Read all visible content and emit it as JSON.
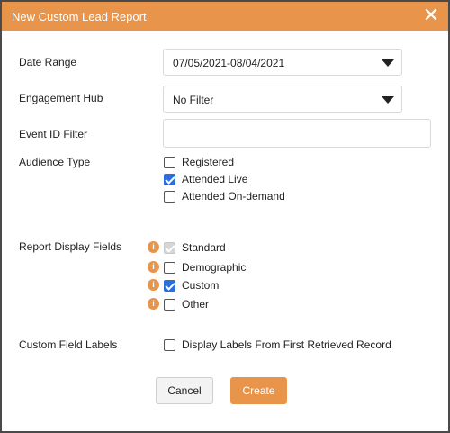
{
  "dialog": {
    "title": "New Custom Lead Report",
    "close_glyph": "✕"
  },
  "date_range": {
    "label": "Date Range",
    "value": "07/05/2021-08/04/2021"
  },
  "engagement_hub": {
    "label": "Engagement Hub",
    "value": "No Filter"
  },
  "event_id": {
    "label": "Event ID Filter",
    "value": "",
    "placeholder": ""
  },
  "audience_type": {
    "label": "Audience Type",
    "options": [
      {
        "label": "Registered",
        "checked": false
      },
      {
        "label": "Attended Live",
        "checked": true
      },
      {
        "label": "Attended On-demand",
        "checked": false
      }
    ]
  },
  "display_fields": {
    "label": "Report Display Fields",
    "info_glyph": "i",
    "options": [
      {
        "label": "Standard",
        "checked": true,
        "disabled": true
      },
      {
        "label": "Demographic",
        "checked": false,
        "disabled": false
      },
      {
        "label": "Custom",
        "checked": true,
        "disabled": false
      },
      {
        "label": "Other",
        "checked": false,
        "disabled": false
      }
    ]
  },
  "custom_labels": {
    "label": "Custom Field Labels",
    "option": {
      "label": "Display Labels From First Retrieved Record",
      "checked": false
    }
  },
  "buttons": {
    "cancel": "Cancel",
    "create": "Create"
  },
  "colors": {
    "accent": "#e8944a",
    "checkbox_checked": "#2a6fdb"
  },
  "icons": {
    "close": "close-icon",
    "dropdown": "chevron-down-icon",
    "info": "info-icon"
  }
}
